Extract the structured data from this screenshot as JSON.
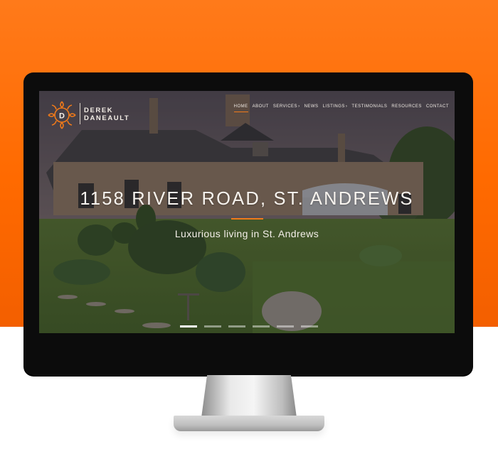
{
  "brand": {
    "line1": "DEREK",
    "line2": "DANEAULT",
    "logo_icon": "dd-monogram-icon",
    "accent": "#f07a1a"
  },
  "nav": [
    {
      "label": "HOME",
      "active": true
    },
    {
      "label": "ABOUT"
    },
    {
      "label": "SERVICES",
      "dropdown": true
    },
    {
      "label": "NEWS"
    },
    {
      "label": "LISTINGS",
      "dropdown": true
    },
    {
      "label": "TESTIMONIALS"
    },
    {
      "label": "RESOURCES"
    },
    {
      "label": "CONTACT"
    }
  ],
  "hero": {
    "title": "1158 RIVER ROAD, ST. ANDREWS",
    "subtitle": "Luxurious living in St. Andrews"
  },
  "slider": {
    "count": 6,
    "active_index": 0
  },
  "colors": {
    "background": "#ff6a00",
    "accent": "#f07a1a"
  }
}
